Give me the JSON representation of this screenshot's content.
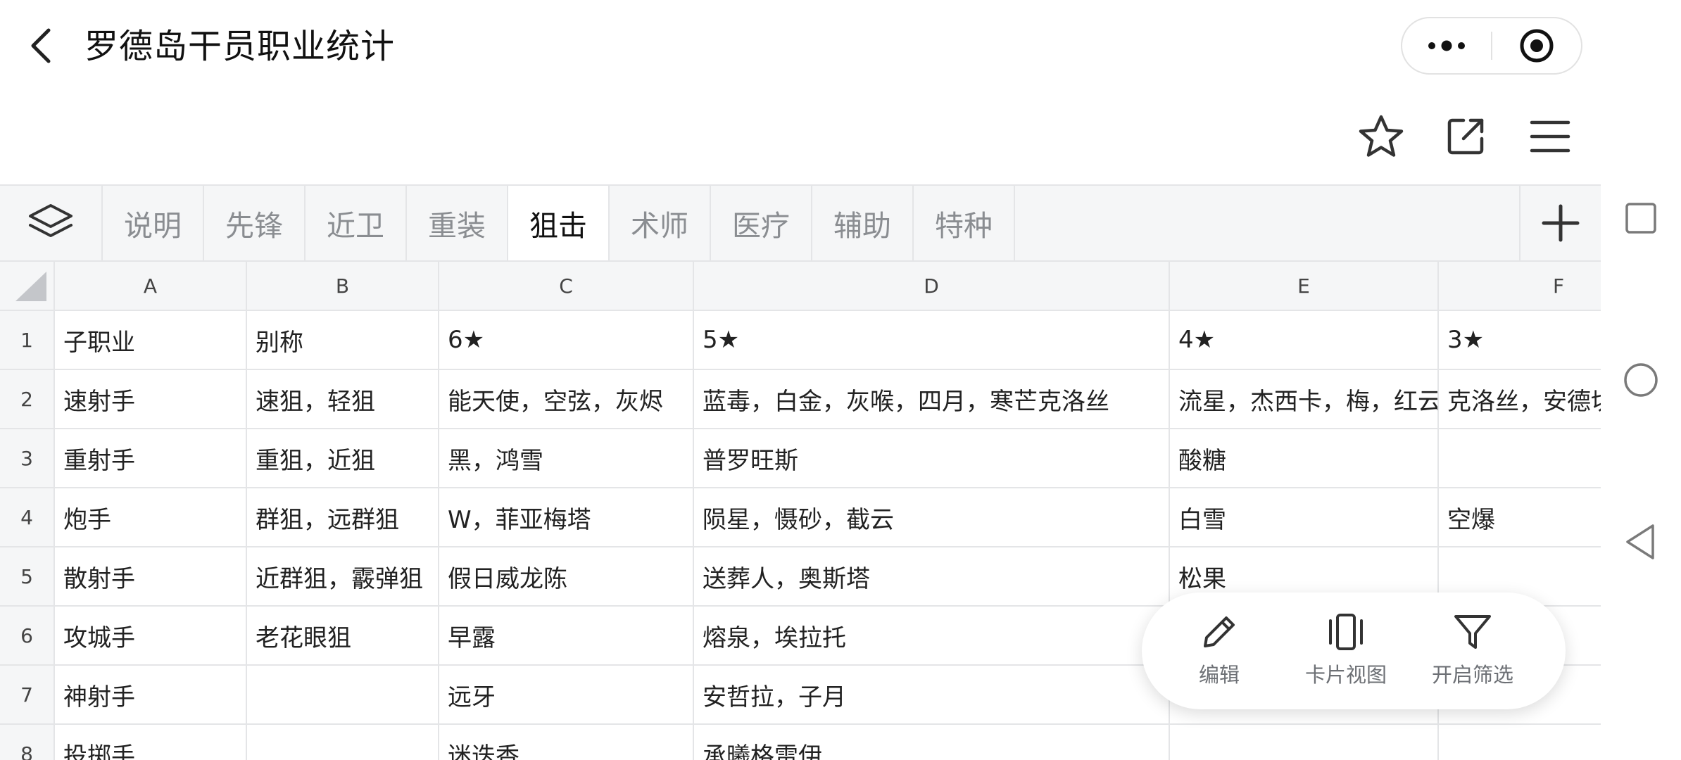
{
  "navbar": {
    "title": "罗德岛干员职业统计"
  },
  "sheet_tabs": [
    "说明",
    "先锋",
    "近卫",
    "重装",
    "狙击",
    "术师",
    "医疗",
    "辅助",
    "特种"
  ],
  "active_tab": "狙击",
  "columns": [
    "A",
    "B",
    "C",
    "D",
    "E",
    "F"
  ],
  "rows": [
    {
      "num": "1",
      "cells": [
        "子职业",
        "别称",
        "6★",
        "5★",
        "4★",
        "3★"
      ]
    },
    {
      "num": "2",
      "cells": [
        "速射手",
        "速狙，轻狙",
        "能天使，空弦，灰烬",
        "蓝毒，白金，灰喉，四月，寒芒克洛丝",
        "流星，杰西卡，梅，红云",
        "克洛丝，安德切尔"
      ]
    },
    {
      "num": "3",
      "cells": [
        "重射手",
        "重狙，近狙",
        "黑，鸿雪",
        "普罗旺斯",
        "酸糖",
        ""
      ]
    },
    {
      "num": "4",
      "cells": [
        "炮手",
        "群狙，远群狙",
        "W，菲亚梅塔",
        "陨星，慑砂，截云",
        "白雪",
        "空爆"
      ]
    },
    {
      "num": "5",
      "cells": [
        "散射手",
        "近群狙，霰弹狙",
        "假日威龙陈",
        "送葬人，奥斯塔",
        "松果",
        ""
      ]
    },
    {
      "num": "6",
      "cells": [
        "攻城手",
        "老花眼狙",
        "早露",
        "熔泉，埃拉托",
        "",
        ""
      ]
    },
    {
      "num": "7",
      "cells": [
        "神射手",
        "",
        "远牙",
        "安哲拉，子月",
        "",
        ""
      ]
    },
    {
      "num": "8",
      "cells": [
        "投掷手",
        "",
        "迷迭香",
        "承曦格雷伊",
        "",
        ""
      ]
    }
  ],
  "fab": {
    "edit": "编辑",
    "card_view": "卡片视图",
    "filter": "开启筛选"
  },
  "icons": {
    "back": "chevron-left-icon",
    "more": "more-dots-icon",
    "close": "target-icon",
    "star": "star-icon",
    "share": "external-link-icon",
    "menu": "hamburger-menu-icon",
    "layers": "layers-icon",
    "add": "plus-icon"
  }
}
